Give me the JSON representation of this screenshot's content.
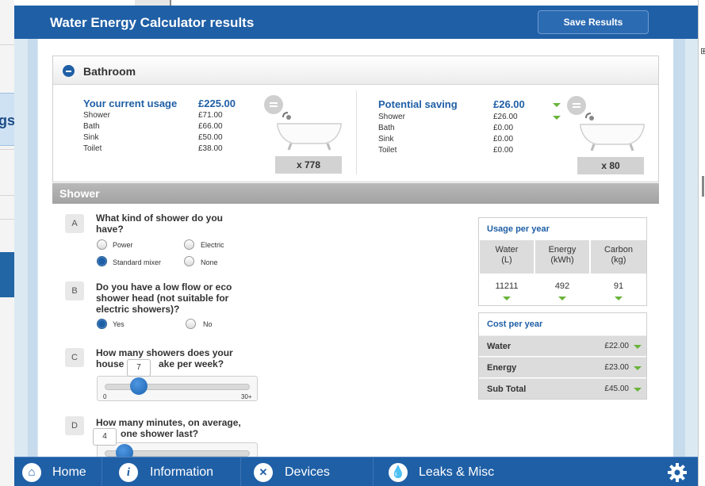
{
  "header": {
    "title": "Water Energy Calculator results",
    "save_label": "Save Results"
  },
  "background": {
    "tab_fragment": "gs"
  },
  "bathroom": {
    "title": "Bathroom",
    "current": {
      "heading": "Your current usage",
      "total": "£225.00",
      "rows": [
        {
          "label": "Shower",
          "value": "£71.00"
        },
        {
          "label": "Bath",
          "value": "£66.00"
        },
        {
          "label": "Sink",
          "value": "£50.00"
        },
        {
          "label": "Toilet",
          "value": "£38.00"
        }
      ],
      "count": "x 778"
    },
    "saving": {
      "heading": "Potential saving",
      "total": "£26.00",
      "rows": [
        {
          "label": "Shower",
          "value": "£26.00"
        },
        {
          "label": "Bath",
          "value": "£0.00"
        },
        {
          "label": "Sink",
          "value": "£0.00"
        },
        {
          "label": "Toilet",
          "value": "£0.00"
        }
      ],
      "count": "x 80"
    }
  },
  "shower": {
    "title": "Shower",
    "questions": [
      {
        "letter": "A",
        "text": "What kind of shower do you have?",
        "options": [
          {
            "label": "Power",
            "selected": false
          },
          {
            "label": "Electric",
            "selected": false
          },
          {
            "label": "Standard mixer",
            "selected": true
          },
          {
            "label": "None",
            "selected": false
          }
        ]
      },
      {
        "letter": "B",
        "text": "Do you have a low flow or eco shower head (not suitable for electric showers)?",
        "options": [
          {
            "label": "Yes",
            "selected": true
          },
          {
            "label": "No",
            "selected": false
          }
        ]
      },
      {
        "letter": "C",
        "text": "How many showers does your house    ake per week?",
        "line1": "How many showers does your",
        "line2": "house",
        "line2b": "ake per week?",
        "slider": {
          "value": "7",
          "min_label": "0",
          "max_label": "30+",
          "fraction": 0.23
        }
      },
      {
        "letter": "D",
        "line1": "How many minutes, on average,",
        "line2": "one shower last?",
        "slider": {
          "value": "4",
          "fraction": 0.12
        }
      }
    ]
  },
  "usage": {
    "title": "Usage per year",
    "columns": [
      {
        "head1": "Water",
        "head2": "(L)",
        "value": "11211"
      },
      {
        "head1": "Energy",
        "head2": "(kWh)",
        "value": "492"
      },
      {
        "head1": "Carbon",
        "head2": "(kg)",
        "value": "91"
      }
    ]
  },
  "cost": {
    "title": "Cost per year",
    "rows": [
      {
        "label": "Water",
        "value": "£22.00"
      },
      {
        "label": "Energy",
        "value": "£23.00"
      },
      {
        "label": "Sub Total",
        "value": "£45.00"
      }
    ]
  },
  "nav": {
    "items": [
      {
        "label": "Home",
        "icon": "home-icon"
      },
      {
        "label": "Information",
        "icon": "info-icon"
      },
      {
        "label": "Devices",
        "icon": "tools-icon"
      },
      {
        "label": "Leaks & Misc",
        "icon": "water-drop-icon"
      }
    ],
    "settings_icon": "gear-icon"
  },
  "colors": {
    "brand": "#1f5fa6",
    "saving_arrow": "#6ab33a"
  }
}
